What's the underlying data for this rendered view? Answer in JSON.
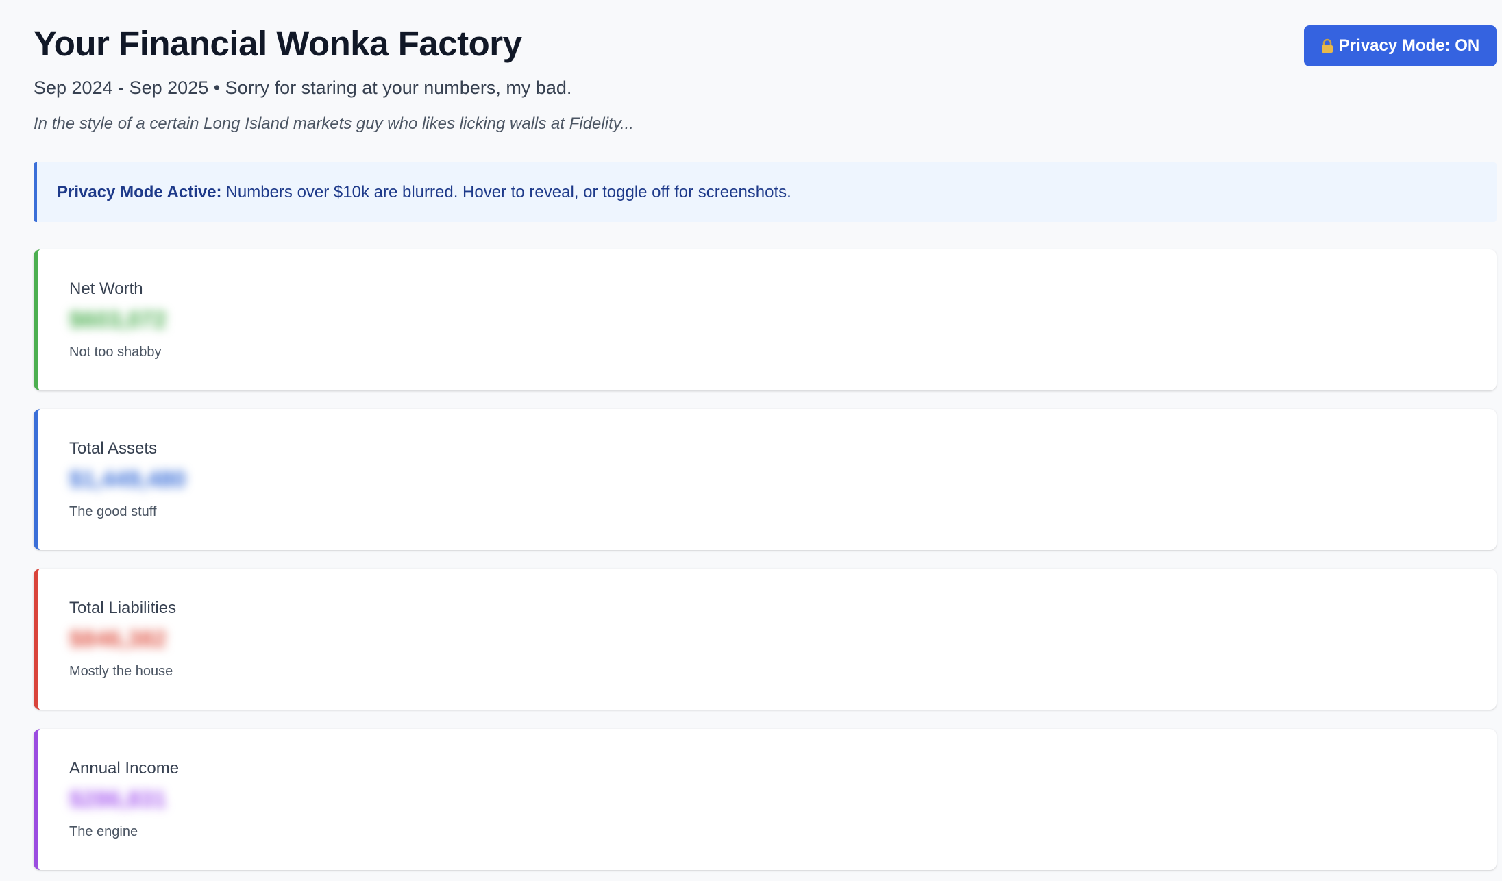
{
  "header": {
    "title": "Your Financial Wonka Factory",
    "subtitle": "Sep 2024 - Sep 2025 • Sorry for staring at your numbers, my bad.",
    "tagline": "In the style of a certain Long Island markets guy who likes licking walls at Fidelity...",
    "privacy_button_label": "Privacy Mode: ON",
    "privacy_button_icon": "lock-icon"
  },
  "notice": {
    "bold": "Privacy Mode Active:",
    "text": "Numbers over $10k are blurred. Hover to reveal, or toggle off for screenshots."
  },
  "cards": [
    {
      "label": "Net Worth",
      "value": "$603,072",
      "note": "Not too shabby",
      "accent": "#4caf50",
      "value_color": "#4caf50"
    },
    {
      "label": "Total Assets",
      "value": "$1,449,480",
      "note": "The good stuff",
      "accent": "#3b6fd8",
      "value_color": "#3b6fd8"
    },
    {
      "label": "Total Liabilities",
      "value": "$846,382",
      "note": "Mostly the house",
      "accent": "#d9443b",
      "value_color": "#e05a4b"
    },
    {
      "label": "Annual Income",
      "value": "$286,831",
      "note": "The engine",
      "accent": "#9b4de0",
      "value_color": "#a95ef0"
    }
  ]
}
